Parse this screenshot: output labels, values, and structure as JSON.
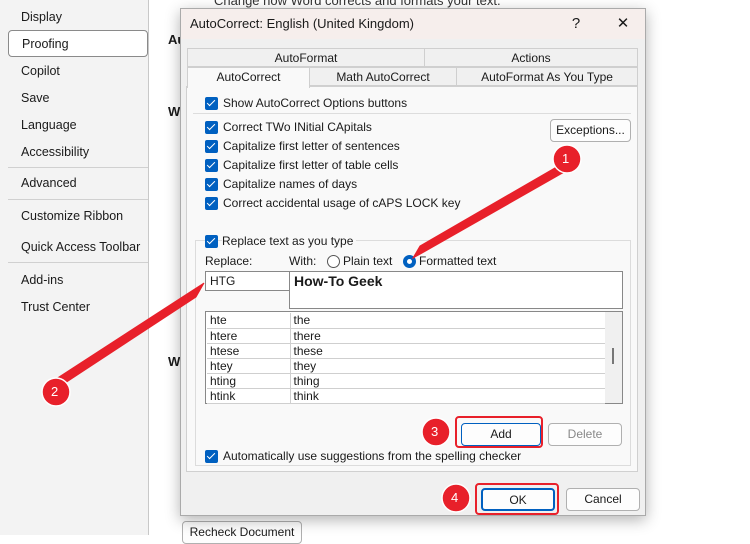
{
  "sidebar": {
    "items": [
      "Display",
      "Proofing",
      "Copilot",
      "Save",
      "Language",
      "Accessibility",
      "Advanced",
      "Customize Ribbon",
      "Quick Access Toolbar",
      "Add-ins",
      "Trust Center"
    ],
    "selected": "Proofing"
  },
  "background": {
    "top_text": "Change how Word corrects and formats your text.",
    "heading1": "Au",
    "heading2": "W",
    "heading3": "W",
    "recheck": "Recheck Document"
  },
  "dialog": {
    "title": "AutoCorrect: English (United Kingdom)",
    "help": "?",
    "close": "✕",
    "tabs_back": [
      "AutoFormat",
      "Actions"
    ],
    "tabs_front": [
      "AutoCorrect",
      "Math AutoCorrect",
      "AutoFormat As You Type"
    ],
    "active_tab": "AutoCorrect",
    "show_buttons": "Show AutoCorrect Options buttons",
    "options": [
      "Correct TWo INitial CApitals",
      "Capitalize first letter of sentences",
      "Capitalize first letter of table cells",
      "Capitalize names of days",
      "Correct accidental usage of cAPS LOCK key"
    ],
    "exceptions": "Exceptions...",
    "replace_as_type": "Replace text as you type",
    "replace_label": "Replace:",
    "with_label": "With:",
    "plain_text": "Plain text",
    "formatted_text": "Formatted text",
    "format_mode": "Formatted text",
    "replace_value": "HTG",
    "with_value": "How-To Geek",
    "entries": [
      [
        "hte",
        "the"
      ],
      [
        "htere",
        "there"
      ],
      [
        "htese",
        "these"
      ],
      [
        "htey",
        "they"
      ],
      [
        "hting",
        "thing"
      ],
      [
        "htink",
        "think"
      ]
    ],
    "add": "Add",
    "delete": "Delete",
    "suggestions": "Automatically use suggestions from the spelling checker",
    "ok": "OK",
    "cancel": "Cancel"
  },
  "annotations": {
    "markers": [
      "1",
      "2",
      "3",
      "4"
    ],
    "color": "#e8202a"
  }
}
